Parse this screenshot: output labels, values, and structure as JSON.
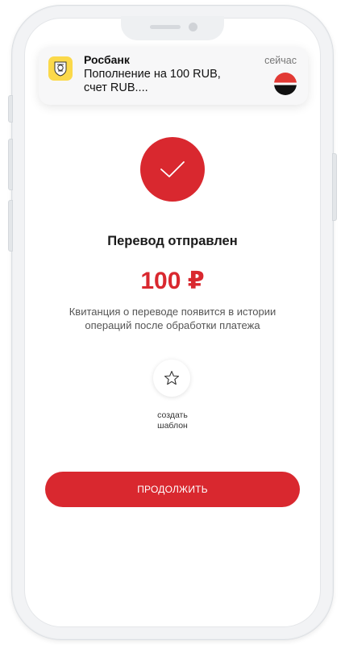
{
  "notification": {
    "title": "Росбанк",
    "body_line1": "Пополнение на 100 RUB,",
    "body_line2": "счет RUB....",
    "time": "сейчас",
    "app_icon": "tinkoff-logo-icon",
    "bank_logo": "rosbank-logo-icon"
  },
  "result": {
    "status_icon": "check-icon",
    "title": "Перевод отправлен",
    "amount": "100 ₽",
    "note_line1": "Квитанция о переводе появится в истории",
    "note_line2": "операций после обработки платежа"
  },
  "template": {
    "icon": "star-icon",
    "label_line1": "создать",
    "label_line2": "шаблон"
  },
  "actions": {
    "continue_label": "ПРОДОЛЖИТЬ"
  },
  "colors": {
    "accent_red": "#d9282f",
    "tinkoff_yellow": "#fbd94a"
  }
}
